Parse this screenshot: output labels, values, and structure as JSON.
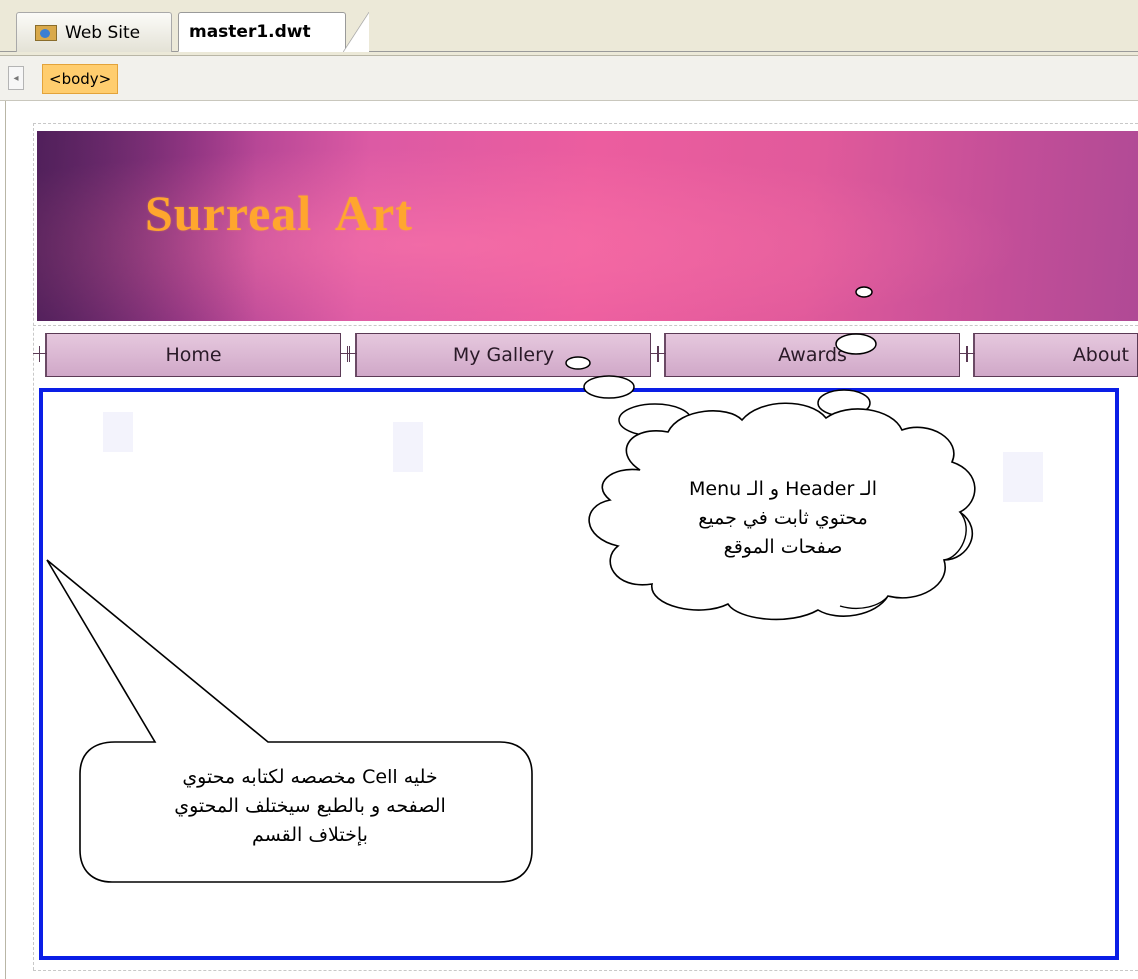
{
  "tabs": {
    "web_site": "Web Site",
    "master": "master1.dwt"
  },
  "tag_selector": {
    "tag": "<body>",
    "scroll_left_icon": "scroll-left-arrow"
  },
  "header": {
    "title": "Surreal  Art",
    "title_color": "#ffa62e"
  },
  "menu": {
    "items": [
      "Home",
      "My Gallery",
      "Awards",
      "About"
    ],
    "border_color": "#5b3a55"
  },
  "content_cell": {
    "border_color": "#0a1ee6"
  },
  "callouts": {
    "cloud_lines": [
      "الـ Header و الـ Menu",
      "محتوي ثابت في جميع",
      "صفحات الموقع"
    ],
    "bubble_lines": [
      "خليه Cell مخصصه لكتابه محتوي",
      "الصفحه و بالطبع سيختلف المحتوي",
      "بإختلاف القسم"
    ]
  }
}
